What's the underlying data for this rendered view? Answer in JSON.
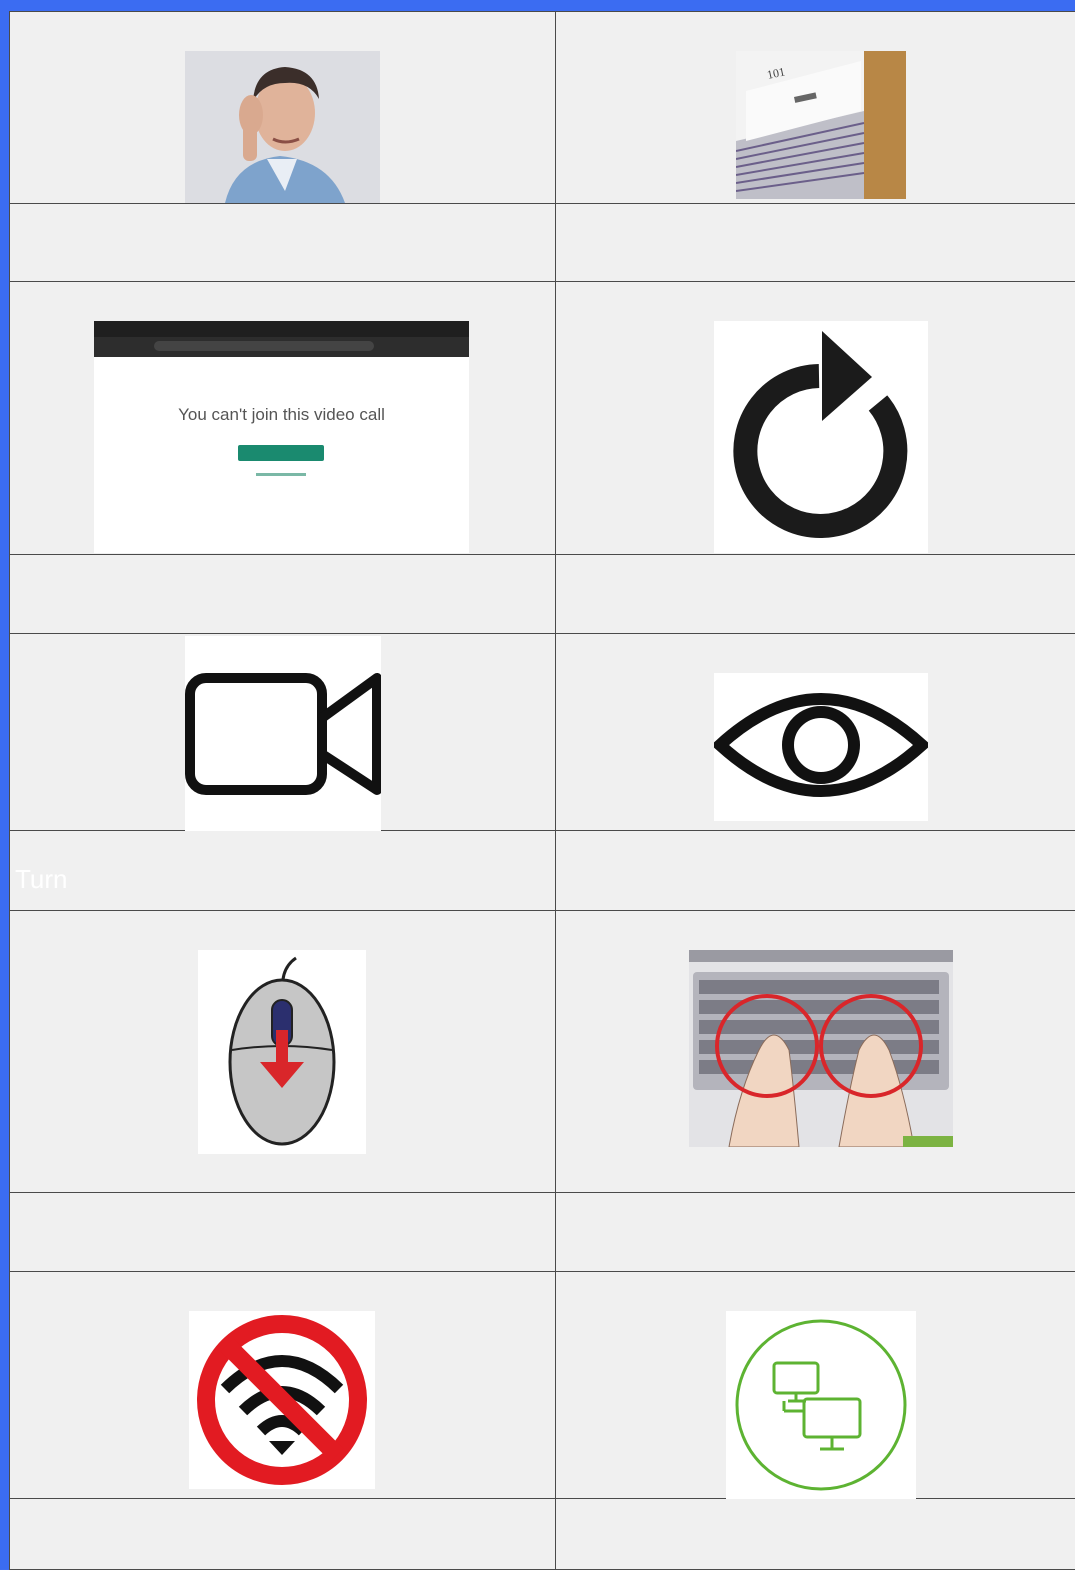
{
  "document": {
    "stray_label": "Turn"
  },
  "cards": [
    {
      "icon": "person-listening-photo",
      "label": ""
    },
    {
      "icon": "book-pages-101-photo",
      "label": ""
    },
    {
      "icon": "video-call-error-screenshot",
      "label": ""
    },
    {
      "icon": "refresh-arrow-icon",
      "label": ""
    },
    {
      "icon": "video-camera-icon",
      "label": ""
    },
    {
      "icon": "eye-icon",
      "label": ""
    },
    {
      "icon": "mouse-scroll-down-icon",
      "label": ""
    },
    {
      "icon": "typing-keyboard-photo",
      "label": ""
    },
    {
      "icon": "no-wifi-icon",
      "label": ""
    },
    {
      "icon": "network-computers-icon",
      "label": ""
    }
  ],
  "screenshot": {
    "message": "You can't join this video call"
  },
  "book_photo": {
    "page_number": "101"
  },
  "colors": {
    "frame": "#3b6cf2",
    "cell_bg": "#f0f0f0",
    "grid_line": "#4a4a4a",
    "no_wifi_red": "#e21b22",
    "network_green": "#5db332",
    "mouse_arrow_red": "#d9262a",
    "mouse_button_navy": "#2b2f6e",
    "call_button_teal": "#1a8a6f"
  }
}
